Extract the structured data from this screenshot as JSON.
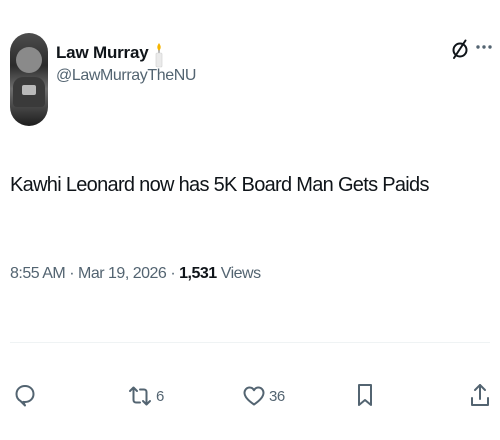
{
  "author": {
    "name": "Law Murray",
    "handle": "@LawMurrayTheNU",
    "badge": "candle-emoji"
  },
  "post": {
    "text": "Kawhi Leonard now has 5K Board Man Gets Paids",
    "time": "8:55 AM",
    "sep1": "·",
    "date": "Mar 19, 2026",
    "sep2": "·",
    "views_count": "1,531",
    "views_label": "Views"
  },
  "actions": {
    "replies": "",
    "reposts": "6",
    "likes": "36"
  },
  "colors": {
    "text": "#0f1419",
    "secondary": "#536471",
    "divider": "#eff3f4"
  }
}
